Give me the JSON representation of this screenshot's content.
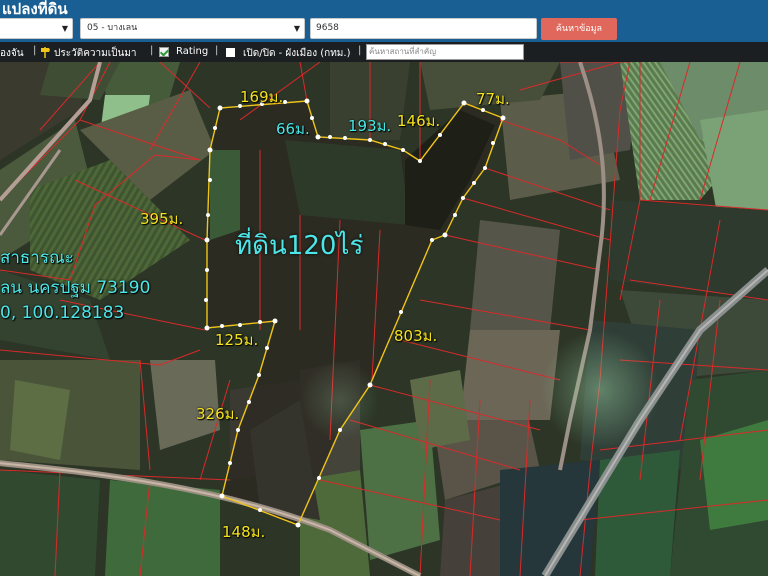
{
  "header": {
    "title": "แปลงที่ดิน",
    "province_value": "",
    "district_value": "05 - บางเลน",
    "parcel_value": "9658",
    "search_button": "ค้นหาข้อมูล"
  },
  "toolbar": {
    "item1": "องจัน",
    "item2": "ประวัติความเป็นมา",
    "item3": "Rating",
    "item4": "เปิด/ปิด - ผังเมือง (กทม.)",
    "landmark_placeholder": "ค้นหาสถานที่สำคัญ",
    "sep": "|"
  },
  "map": {
    "area": "ที่ดิน120ไร่",
    "address_line1": "สาธารณะ",
    "address_line2": "ลน นครปฐม 73190",
    "address_line3": "0, 100.128183",
    "dims": {
      "d169": "169ม.",
      "d66": "66ม.",
      "d193": "193ม.",
      "d146": "146ม.",
      "d77": "77ม.",
      "d395": "395ม.",
      "d125": "125ม.",
      "d803": "803ม.",
      "d326": "326ม.",
      "d148": "148ม."
    }
  }
}
